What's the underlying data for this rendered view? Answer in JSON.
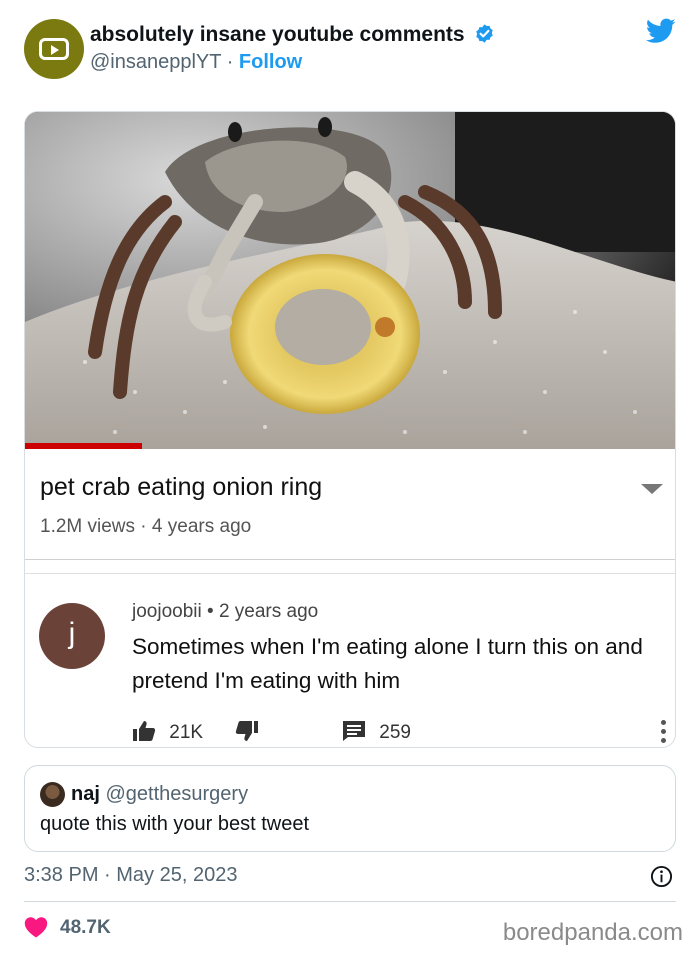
{
  "author": {
    "display_name": "absolutely insane youtube comments",
    "handle": "@insanepplYT",
    "separator": "·",
    "follow_label": "Follow"
  },
  "icons": {
    "avatar": "youtube-logo-icon",
    "verified": "verified-badge-icon",
    "brand": "twitter-bird-icon",
    "like": "heart-icon",
    "info": "info-icon"
  },
  "colors": {
    "twitter_blue": "#1d9bf0",
    "like_red": "#f91880",
    "avatar_olive": "#7a7a10",
    "youtube_red": "#cc0000"
  },
  "youtube_card": {
    "video_progress": 0.18,
    "video_title": "pet crab eating onion ring",
    "views": "1.2M views",
    "age": "4 years ago",
    "comment": {
      "avatar_letter": "j",
      "author": "joojoobii",
      "posted": "2 years ago",
      "text": "Sometimes when I'm eating alone I turn this on and pretend I'm eating with him",
      "likes": "21K",
      "replies": "259"
    }
  },
  "quoted_tweet": {
    "name": "naj",
    "handle": "@getthesurgery",
    "text": "quote this with your best tweet"
  },
  "tweet": {
    "timestamp": "3:38 PM · May 25, 2023",
    "like_count": "48.7K"
  },
  "watermark": "boredpanda.com"
}
